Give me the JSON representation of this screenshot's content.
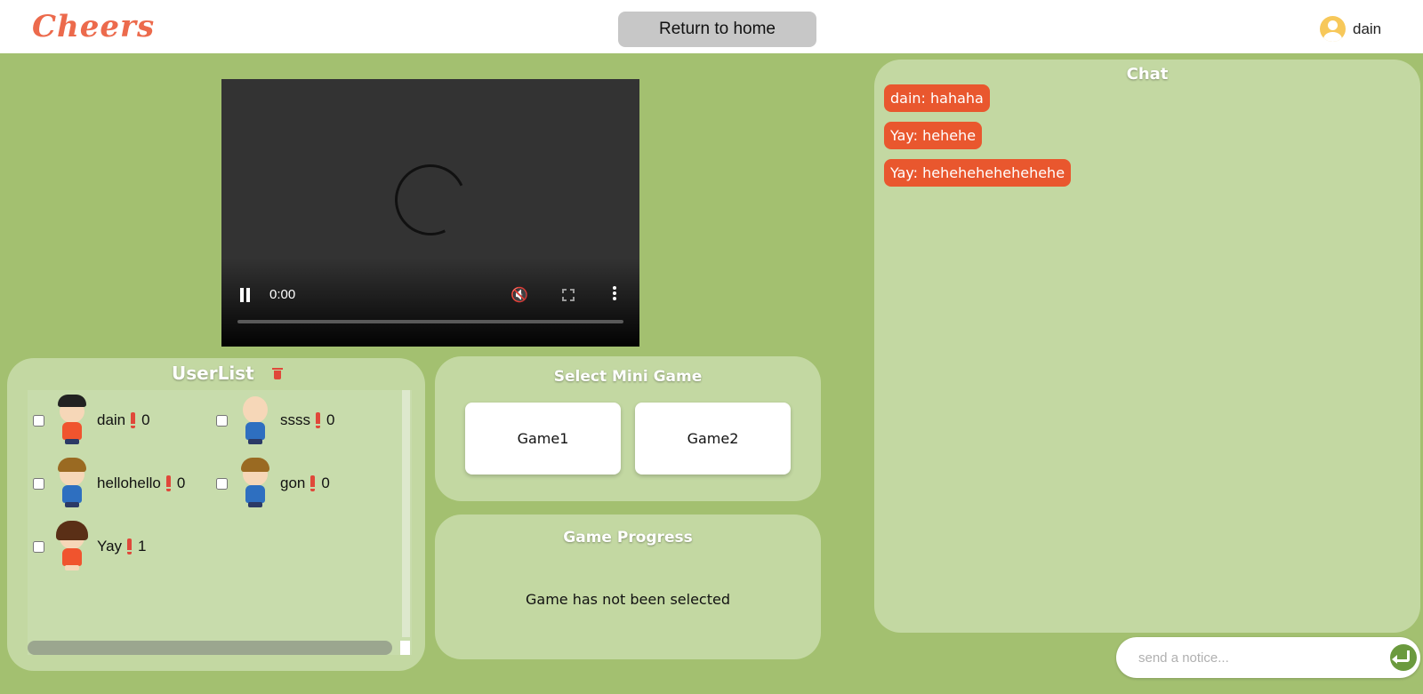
{
  "header": {
    "logo": "Cheers",
    "home_button": "Return to home",
    "user_name": "dain"
  },
  "video": {
    "time": "0:00"
  },
  "userlist": {
    "title": "UserList",
    "users": [
      {
        "name": "dain",
        "count": "0"
      },
      {
        "name": "ssss",
        "count": "0"
      },
      {
        "name": "hellohello",
        "count": "0"
      },
      {
        "name": "gon",
        "count": "0"
      },
      {
        "name": "Yay",
        "count": "1"
      }
    ]
  },
  "minigame": {
    "title": "Select Mini Game",
    "games": [
      "Game1",
      "Game2"
    ]
  },
  "progress": {
    "title": "Game Progress",
    "message": "Game has not been selected"
  },
  "chat": {
    "title": "Chat",
    "messages": [
      "dain: hahaha",
      "Yay: hehehe",
      "Yay: hehehehehehehehe"
    ],
    "notice_placeholder": "send a notice..."
  },
  "colors": {
    "accent": "#e9572e",
    "background": "#a3c070",
    "panel": "#c3d8a2"
  }
}
